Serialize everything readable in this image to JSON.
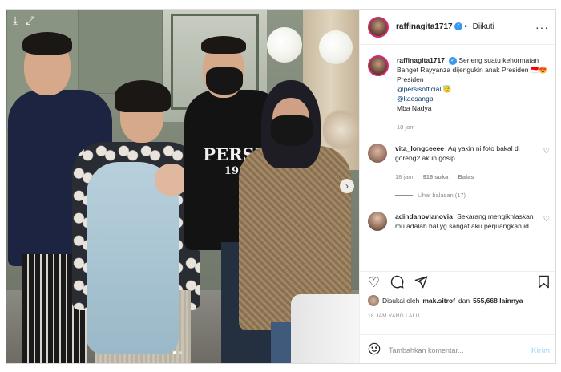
{
  "post": {
    "username": "raffinagita1717",
    "follow_label": "Diikuti",
    "more_icon": "more-dots-icon",
    "verified_icon": "verified-badge-icon"
  },
  "photo": {
    "tshirt_word": "PERSIS",
    "tshirt_year": "1923",
    "next_icon": "chevron-right-icon"
  },
  "caption": {
    "username": "raffinagita1717",
    "line1": "Seneng suatu kehormatan Banget Rayyanza dijengukin anak Presiden 🇮🇩😍 Presiden",
    "mention1": "@persisofficial",
    "mention1_emoji": "😇",
    "mention2": "@kaesangp",
    "line2": "Mba Nadya",
    "time": "18 jam"
  },
  "comments": [
    {
      "username": "vita_longceeee",
      "text": "Aq yakin ni foto bakal di goreng2 akun gosip",
      "time": "18 jam",
      "likes": "916 suka",
      "reply": "Balas",
      "view_replies": "Lihat balasan (17)"
    },
    {
      "username": "adindanovianovia",
      "text": "Sekarang mengikhlaskan mu adalah hal yg sangat aku perjuangkan,id"
    }
  ],
  "actions": {
    "like_icon": "heart-icon",
    "comment_icon": "comment-icon",
    "share_icon": "share-icon",
    "save_icon": "bookmark-icon"
  },
  "likes": {
    "prefix": "Disukai oleh",
    "user": "mak.sitrof",
    "joiner": "dan",
    "count": "555,668 lainnya"
  },
  "post_time": "18 JAM YANG LALU",
  "comment_box": {
    "placeholder": "Tambahkan komentar...",
    "post_label": "Kirim",
    "emoji_icon": "emoji-icon"
  },
  "colors": {
    "link": "#00376b",
    "verified": "#3897f0",
    "post_button": "#b2dffc",
    "muted": "#8e8e8e"
  }
}
